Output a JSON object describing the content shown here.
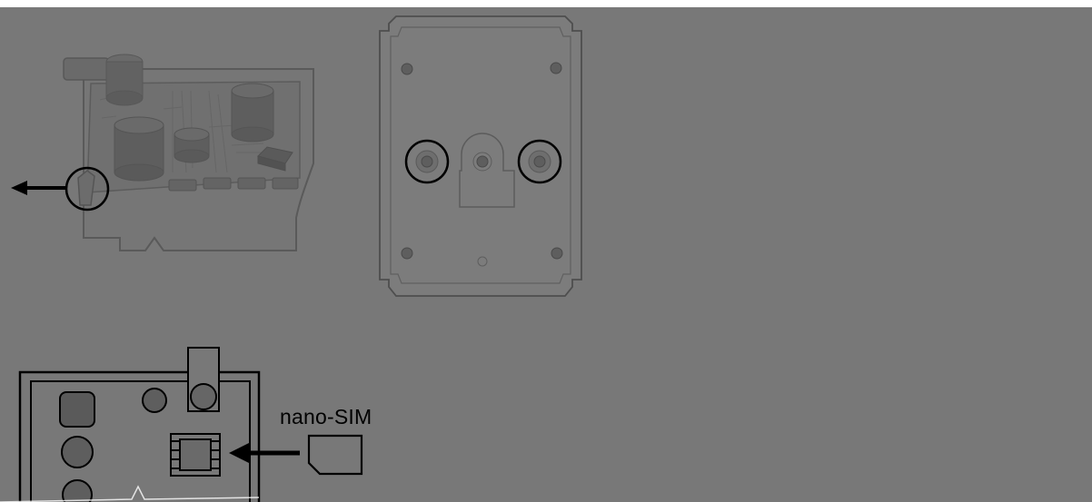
{
  "diagram": {
    "sim_label": "nano-SIM",
    "colors": {
      "overlay": "#787878",
      "outline": "#000000",
      "faint_outline": "#4e4e4e",
      "part_fill": "#6e6e6e",
      "component_fill": "#5f5f5f"
    },
    "panels": [
      {
        "name": "circuit-board-panel",
        "icon": "pcb-with-release-latch"
      },
      {
        "name": "enclosure-back-panel",
        "icon": "enclosure-screws"
      },
      {
        "name": "sim-slot-panel",
        "icon": "nano-sim-card-insert"
      }
    ]
  }
}
